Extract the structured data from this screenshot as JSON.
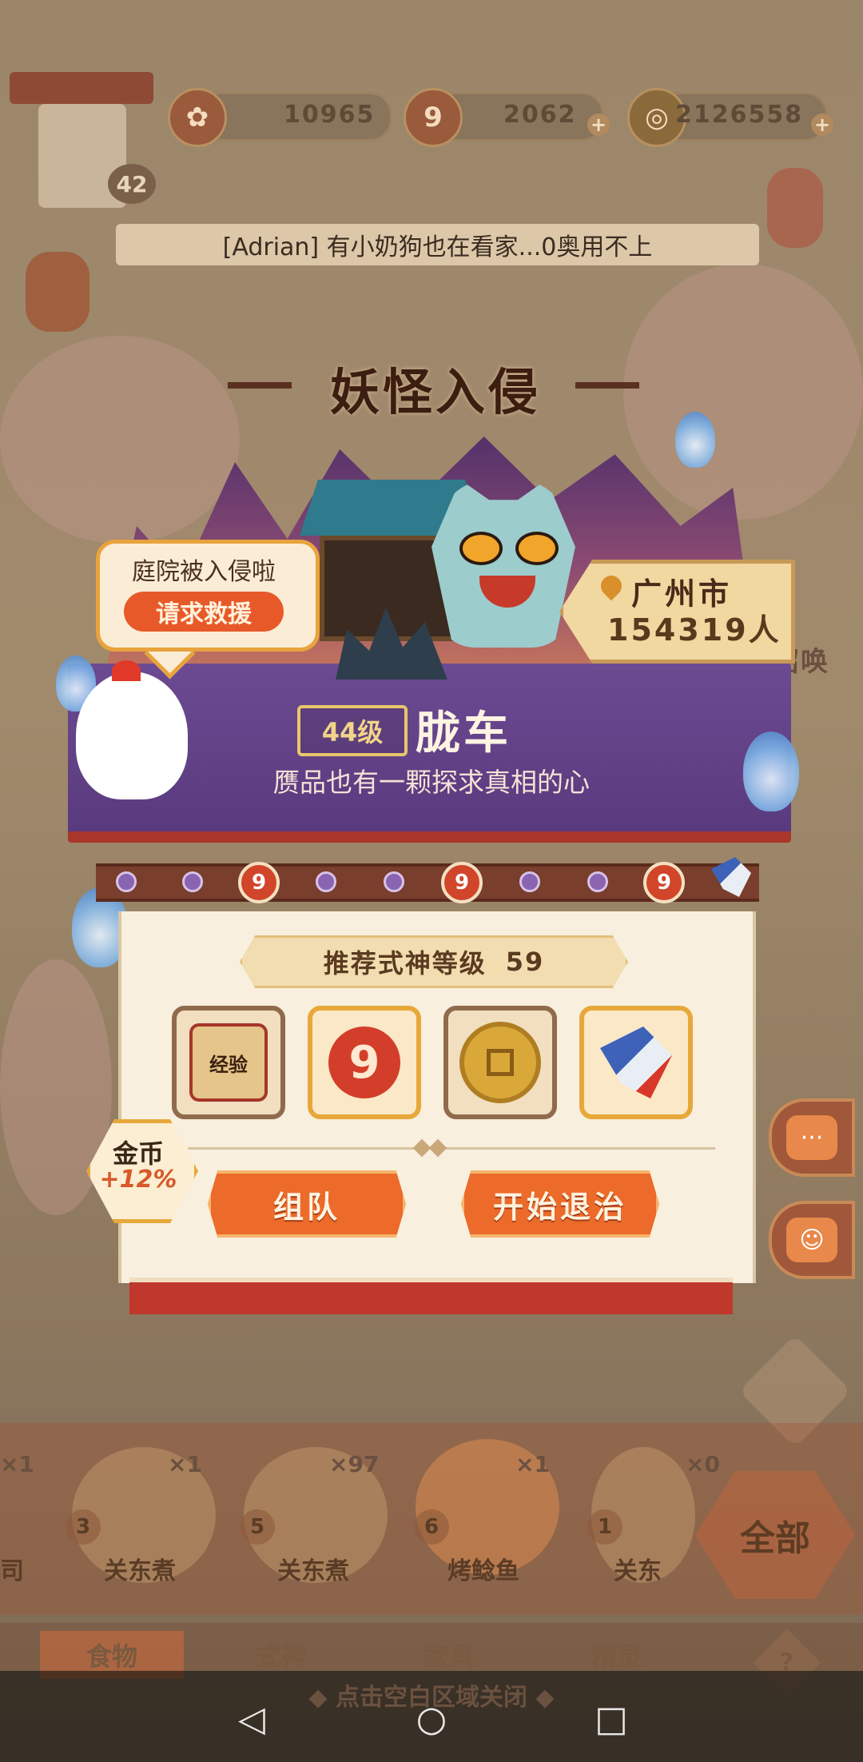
{
  "resources": [
    {
      "icon": "flower-token-icon",
      "value": "10965",
      "has_plus": false
    },
    {
      "icon": "magatama-icon",
      "value": "2062",
      "has_plus": true
    },
    {
      "icon": "coin-icon",
      "value": "2126558",
      "has_plus": true
    }
  ],
  "player": {
    "level": "42"
  },
  "marquee": {
    "text": "[Adrian] 有小奶狗也在看家...0奥用不上"
  },
  "event": {
    "title": "妖怪入侵",
    "help_text": "庭院被入侵啦",
    "help_button": "请求救援",
    "location_city": "广州市",
    "location_population": "154319人",
    "monster_level": "44级",
    "monster_name": "胧车",
    "monster_desc": "赝品也有一颗探求真相的心",
    "progress_markers": [
      "9",
      "9",
      "9"
    ]
  },
  "panel": {
    "recommend_label": "推荐式神等级",
    "recommend_level": "59",
    "rewards": [
      {
        "icon": "exp-scroll-icon",
        "label": "经验"
      },
      {
        "icon": "magatama-icon",
        "label": "9"
      },
      {
        "icon": "coin-icon",
        "label": ""
      },
      {
        "icon": "bird-icon",
        "label": ""
      }
    ],
    "bonus_label": "金币",
    "bonus_value": "+12%",
    "team_button": "组队",
    "start_button": "开始退治"
  },
  "shelf": {
    "items": [
      {
        "name": "司",
        "count": "×1",
        "level": ""
      },
      {
        "name": "关东煮",
        "count": "×1",
        "level": "3"
      },
      {
        "name": "关东煮",
        "count": "×97",
        "level": "5"
      },
      {
        "name": "烤鲶鱼",
        "count": "×1",
        "level": "6"
      },
      {
        "name": "关东",
        "count": "×0",
        "level": "1"
      }
    ],
    "all_button": "全部"
  },
  "tabs": [
    "食物",
    "式神",
    "家具",
    "精灵"
  ],
  "hint": "◆ 点击空白区域关闭 ◆",
  "side_text": "召唤"
}
